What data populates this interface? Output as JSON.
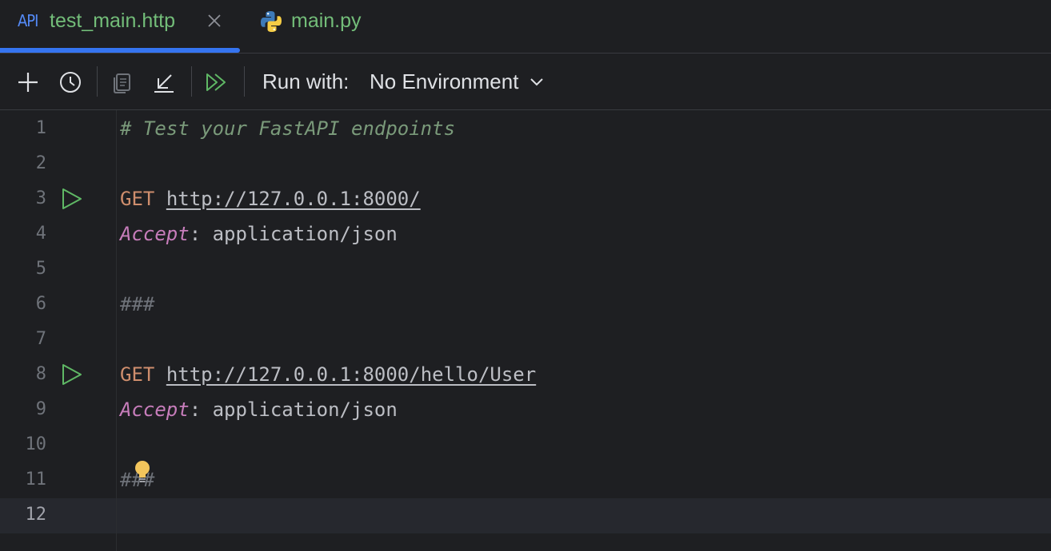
{
  "tabs": [
    {
      "badge": "API",
      "title": "test_main.http",
      "active": true,
      "icon": "api-icon"
    },
    {
      "title": "main.py",
      "active": false,
      "icon": "python-icon"
    }
  ],
  "toolbar": {
    "buttons": [
      "add-icon",
      "history-icon",
      "copy-icon",
      "import-icon",
      "run-all-icon"
    ],
    "run_with_label": "Run with:",
    "environment": "No Environment"
  },
  "editor": {
    "current_line": 12,
    "line_numbers": [
      "1",
      "2",
      "3",
      "4",
      "5",
      "6",
      "7",
      "8",
      "9",
      "10",
      "11",
      "12"
    ],
    "lines": {
      "l1": "# Test your FastAPI endpoints",
      "l3_method": "GET",
      "l3_url": "http://127.0.0.1:8000/",
      "l4_header": "Accept",
      "l4_colon": ":",
      "l4_value": " application/json",
      "l6": "###",
      "l8_method": "GET",
      "l8_url": "http://127.0.0.1:8000/hello/User",
      "l9_header": "Accept",
      "l9_colon": ":",
      "l9_value": " application/json",
      "l11": "###"
    }
  },
  "colors": {
    "accent": "#3574f0",
    "run": "#5fb865",
    "tab_title": "#73bd79"
  }
}
